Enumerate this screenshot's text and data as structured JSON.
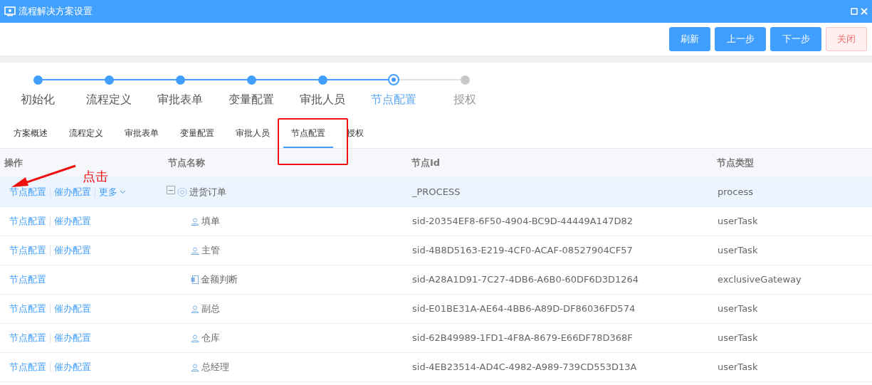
{
  "window": {
    "title": "流程解决方案设置"
  },
  "toolbar": {
    "buttons": [
      {
        "label": "刷新",
        "kind": "primary"
      },
      {
        "label": "上一步",
        "kind": "primary"
      },
      {
        "label": "下一步",
        "kind": "primary"
      },
      {
        "label": "关闭",
        "kind": "danger"
      }
    ]
  },
  "steps": [
    {
      "label": "初始化",
      "completed": true,
      "selected": false
    },
    {
      "label": "流程定义",
      "completed": true,
      "selected": false
    },
    {
      "label": "审批表单",
      "completed": true,
      "selected": false
    },
    {
      "label": "变量配置",
      "completed": true,
      "selected": false
    },
    {
      "label": "审批人员",
      "completed": true,
      "selected": false
    },
    {
      "label": "节点配置",
      "completed": false,
      "selected": true
    },
    {
      "label": "授权",
      "completed": false,
      "selected": false
    }
  ],
  "tabs": [
    {
      "label": "方案概述",
      "selected": false
    },
    {
      "label": "流程定义",
      "selected": false
    },
    {
      "label": "审批表单",
      "selected": false
    },
    {
      "label": "变量配置",
      "selected": false
    },
    {
      "label": "审批人员",
      "selected": false
    },
    {
      "label": "节点配置",
      "selected": true
    },
    {
      "label": "授权",
      "selected": false
    }
  ],
  "table": {
    "columns": [
      "操作",
      "节点名称",
      "节点Id",
      "节点类型"
    ],
    "rows": [
      {
        "actions": [
          "节点配置",
          "催办配置"
        ],
        "more": "更多",
        "name": "进货订单",
        "id": "_PROCESS",
        "type": "process",
        "kind": "process",
        "selected": true,
        "expanded": true,
        "children": [
          {
            "actions": [
              "节点配置",
              "催办配置"
            ],
            "name": "填单",
            "id": "sid-20354EF8-6F50-4904-BC9D-44449A147D82",
            "type": "userTask",
            "kind": "user",
            "selected": false
          },
          {
            "actions": [
              "节点配置",
              "催办配置"
            ],
            "name": "主管",
            "id": "sid-4B8D5163-E219-4CF0-ACAF-08527904CF57",
            "type": "userTask",
            "kind": "user",
            "selected": false
          },
          {
            "actions": [
              "节点配置"
            ],
            "name": "金额判断",
            "id": "sid-A28A1D91-7C27-4DB6-A6B0-60DF6D3D1264",
            "type": "exclusiveGateway",
            "kind": "gateway",
            "selected": false
          },
          {
            "actions": [
              "节点配置",
              "催办配置"
            ],
            "name": "副总",
            "id": "sid-E01BE31A-AE64-4BB6-A89D-DF86036FD574",
            "type": "userTask",
            "kind": "user",
            "selected": false
          },
          {
            "actions": [
              "节点配置",
              "催办配置"
            ],
            "name": "仓库",
            "id": "sid-62B49989-1FD1-4F8A-8679-E66DF78D368F",
            "type": "userTask",
            "kind": "user",
            "selected": false
          },
          {
            "actions": [
              "节点配置",
              "催办配置"
            ],
            "name": "总经理",
            "id": "sid-4EB23514-AD4C-4982-A989-739CD553D13A",
            "type": "userTask",
            "kind": "user",
            "selected": false
          }
        ]
      }
    ]
  },
  "annotation": {
    "label": "点击"
  }
}
